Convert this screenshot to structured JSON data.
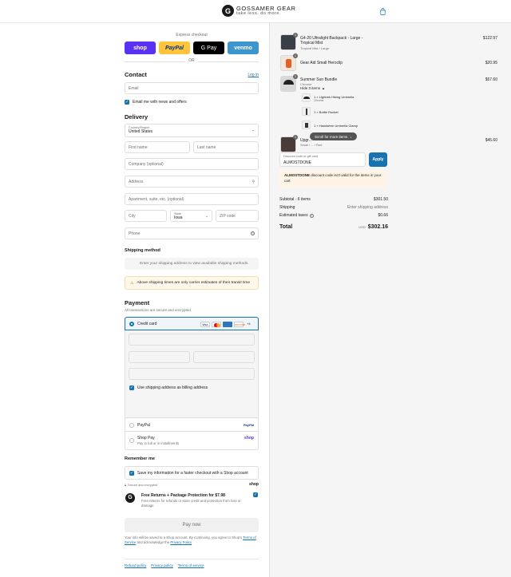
{
  "header": {
    "brand": "GOSSAMER GEAR",
    "tagline": "take less. do more.",
    "logo_letter": "G",
    "bag_icon": "shopping-bag-icon"
  },
  "express": {
    "title": "Express checkout",
    "buttons": [
      {
        "label": "shop",
        "bg": "#5a31f4",
        "fg": "#ffffff"
      },
      {
        "label": "PayPal",
        "bg": "#ffc439",
        "fg": "#003087"
      },
      {
        "label": "G Pay",
        "bg": "#000000",
        "fg": "#ffffff"
      },
      {
        "label": "venmo",
        "bg": "#3d95ce",
        "fg": "#ffffff"
      }
    ],
    "or": "OR"
  },
  "contact": {
    "title": "Contact",
    "login": "Log in",
    "email_placeholder": "Email",
    "news_label": "Email me with news and offers"
  },
  "delivery": {
    "title": "Delivery",
    "country_label": "Country/Region",
    "country_value": "United States",
    "first_name": "First name",
    "last_name": "Last name",
    "company": "Company (optional)",
    "address": "Address",
    "apartment": "Apartment, suite, etc. (optional)",
    "city": "City",
    "state_label": "State",
    "state_value": "Iowa",
    "zip": "ZIP code",
    "phone": "Phone"
  },
  "shipping": {
    "title": "Shipping method",
    "placeholder": "Enter your shipping address to view available shipping methods.",
    "notice": "Above shipping times are only carrier estimates of their transit time"
  },
  "payment": {
    "title": "Payment",
    "subtitle": "All transactions are secure and encrypted.",
    "credit_card": "Credit card",
    "card_brands": [
      "VISA",
      "MC",
      "AMEX",
      "DISCOVER",
      "+4"
    ],
    "billing_same": "Use shipping address as billing address",
    "paypal": "PayPal",
    "shop_pay": "Shop Pay",
    "shop_pay_sub": "Pay in full or in installments"
  },
  "remember": {
    "title": "Remember me",
    "save_info": "Save my information for a faster checkout with a Shop account",
    "secure": "Secure and encrypted",
    "shop_logo": "shop"
  },
  "protection": {
    "title": "Free Returns + Package Protection for $7.98",
    "desc": "Free returns for refunds or store credit and protection from loss or damage"
  },
  "pay_now": "Pay now",
  "legal": {
    "text_1": "Your info will be saved to a Shop account. By continuing, you agree to Shop's",
    "terms": "Terms of Service",
    "and": "and acknowledge the",
    "privacy": "Privacy Policy"
  },
  "footer_links": [
    "Refund policy",
    "Privacy policy",
    "Terms of service"
  ],
  "summary": {
    "items": [
      {
        "qty": "1",
        "name": "G4-20 Ultralight Backpack - Large - Tropical Mist",
        "sub": "Tropical Mist / Large",
        "price": "$122.97"
      },
      {
        "qty": "1",
        "name": "Gear Aid Small Heroclip",
        "sub": "",
        "price": "$20.95"
      },
      {
        "qty": "1",
        "name": "Summer Sun Bundle",
        "sub": "Chrome",
        "price": "$57.60"
      },
      {
        "qty": "1",
        "name": "Upgr...",
        "sub": "Small / ... / Red",
        "price": "$45.60"
      }
    ],
    "bundle_toggle": "Hide 3 items",
    "bundle_items": [
      {
        "name": "1 × Lightrek Hiking Umbrella",
        "sub": "Chrome"
      },
      {
        "name": "1 × Bottle Rocket",
        "sub": ""
      },
      {
        "name": "1 × Handsfree Umbrella Clamp",
        "sub": ""
      }
    ],
    "scroll_hint": "Scroll for more items",
    "discount_label": "Discount code or gift card",
    "discount_value": "ALMOSTDONE",
    "apply": "Apply",
    "discount_code_bold": "ALMOSTDONE",
    "discount_error": "discount code isn't valid for the items in your cart",
    "subtotal_label": "Subtotal · 6 items",
    "subtotal_value": "$301.50",
    "shipping_label": "Shipping",
    "shipping_value": "Enter shipping address",
    "taxes_label": "Estimated taxes",
    "taxes_value": "$0.66",
    "total_label": "Total",
    "currency": "USD",
    "total_value": "$302.16"
  },
  "colors": {
    "accent": "#1773b0",
    "warning_bg": "#fff8ea",
    "error_bg": "#fff4e5"
  }
}
